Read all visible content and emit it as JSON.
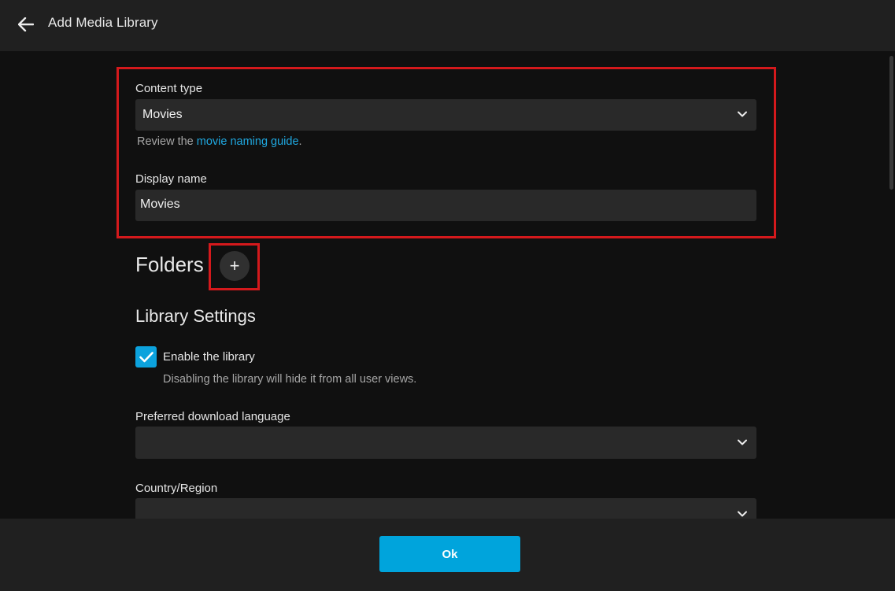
{
  "header": {
    "title": "Add Media Library",
    "back_icon": "arrow-left-icon"
  },
  "content_type": {
    "label": "Content type",
    "value": "Movies",
    "helper_prefix": "Review the ",
    "helper_link": "movie naming guide",
    "helper_suffix": "."
  },
  "display_name": {
    "label": "Display name",
    "value": "Movies"
  },
  "folders": {
    "title": "Folders",
    "add_symbol": "+"
  },
  "library_settings": {
    "title": "Library Settings",
    "enable_label": "Enable the library",
    "enable_checked": true,
    "enable_helper": "Disabling the library will hide it from all user views.",
    "download_language_label": "Preferred download language",
    "download_language_value": "",
    "country_label": "Country/Region",
    "country_value": ""
  },
  "footer": {
    "ok_label": "Ok"
  },
  "colors": {
    "accent": "#00a4dc",
    "link": "#1fa8e0",
    "highlight": "#d4191c",
    "header_bg": "#202020",
    "page_bg": "#101010",
    "field_bg": "#292929"
  }
}
